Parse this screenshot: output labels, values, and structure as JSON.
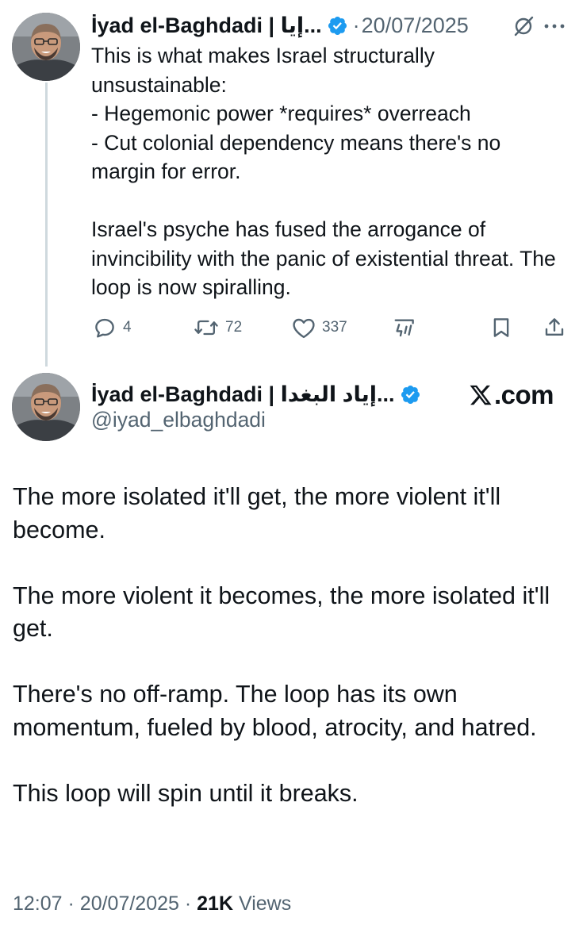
{
  "reply_tweet": {
    "author_name": "İyad el-Baghdadi | إيا...",
    "separator": "·",
    "date": "20/07/2025",
    "text": "This is what makes Israel structurally unsustainable:\n- Hegemonic power *requires* overreach\n- Cut colonial dependency means there's no margin for error.\n\nIsrael's psyche has fused the arrogance of invincibility with the panic of existential threat. The loop is now spiralling.",
    "actions": {
      "replies": "4",
      "reposts": "72",
      "likes": "337"
    },
    "icons": [
      "verified-badge-icon",
      "grok-icon",
      "more-icon",
      "reply-icon",
      "repost-icon",
      "like-icon",
      "views-icon",
      "bookmark-icon",
      "share-icon"
    ]
  },
  "main_tweet": {
    "author_name": "İyad el-Baghdadi | إياد البغدا...",
    "handle": "@iyad_elbaghdadi",
    "site_label": ".com",
    "text": "The more isolated it'll get, the more violent it'll become.\n\nThe more violent it becomes, the more isolated it'll get.\n\nThere's no off-ramp. The loop has its own momentum, fueled by blood, atrocity, and hatred.\n\nThis loop will spin until it breaks.",
    "time": "12:07",
    "separator": "·",
    "date": "20/07/2025",
    "views_count": "21K",
    "views_label": "Views"
  },
  "colors": {
    "text": "#0f1419",
    "secondary": "#536471",
    "verified": "#1d9bf0",
    "thread_line": "#cfd9de"
  }
}
